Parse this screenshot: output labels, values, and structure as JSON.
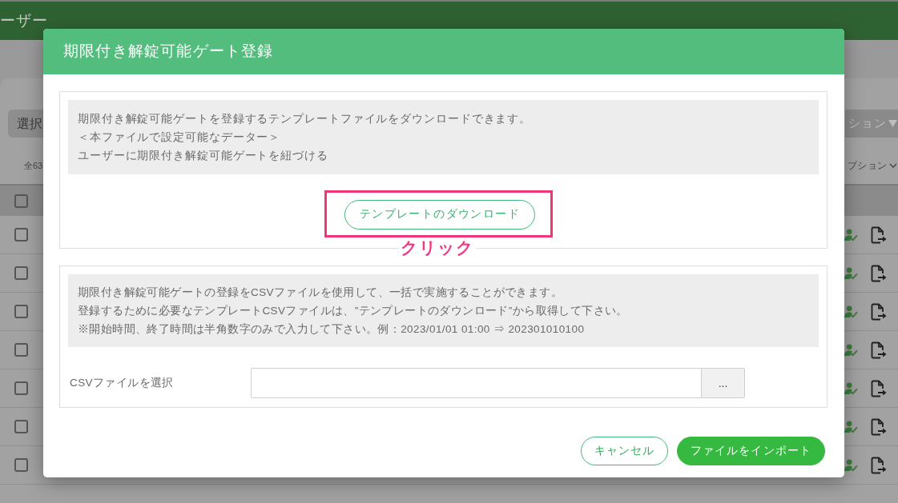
{
  "app_bar": {
    "title": "ーザー"
  },
  "toolbar": {
    "select_button": "選択",
    "action_button": "ション",
    "total": "全63",
    "options_menu": "プション"
  },
  "table": {
    "header": {
      "checked": false
    },
    "rows": [
      {
        "checked": false
      },
      {
        "checked": false
      },
      {
        "checked": false
      },
      {
        "checked": false
      },
      {
        "checked": false
      },
      {
        "checked": false
      },
      {
        "checked": false
      }
    ]
  },
  "dialog": {
    "title": "期限付き解錠可能ゲート登録",
    "template_section": {
      "info_lines": [
        "期限付き解錠可能ゲートを登録するテンプレートファイルをダウンロードできます。",
        "＜本ファイルで設定可能なデーター＞",
        "ユーザーに期限付き解錠可能ゲートを紐づける"
      ],
      "download_button": "テンプレートのダウンロード",
      "annotation": "クリック"
    },
    "import_section": {
      "info_lines": [
        "期限付き解錠可能ゲートの登録をCSVファイルを使用して、一括で実施することができます。",
        "登録するために必要なテンプレートCSVファイルは、”テンプレートのダウンロード”から取得して下さい。",
        "※開始時間、終了時間は半角数字のみで入力して下さい。例：2023/01/01 01:00 ⇒ 202301010100"
      ],
      "file_label": "CSVファイルを選択",
      "browse_button": "..."
    },
    "buttons": [
      {
        "label": "キャンセル",
        "kind": "outline"
      },
      {
        "label": "ファイルをインポート",
        "kind": "solid"
      }
    ]
  }
}
